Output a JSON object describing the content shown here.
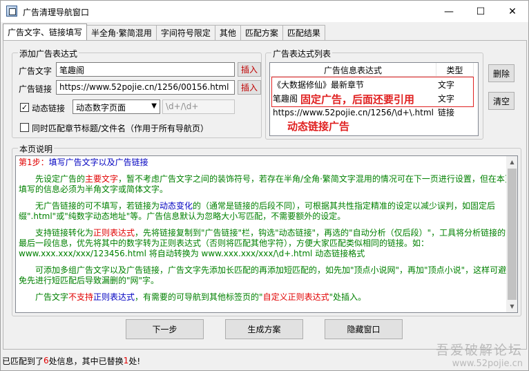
{
  "window": {
    "title": "广告清理导航窗口",
    "min_symbol": "—",
    "max_symbol": "☐",
    "close_symbol": "✕"
  },
  "tabs": [
    "广告文字、链接填写",
    "半全角·繁简混用",
    "字间符号限定",
    "其他",
    "匹配方案",
    "匹配结果"
  ],
  "add_group": {
    "title": "添加广告表达式",
    "ad_text_label": "广告文字",
    "ad_text_value": "笔趣阁",
    "ad_link_label": "广告链接",
    "ad_link_value": "https://www.52pojie.cn/1256/00156.html",
    "insert_label": "插入",
    "dynamic_label": "动态链接",
    "dynamic_checked": "✓",
    "dynamic_mode": "动态数字页面",
    "regex_value": "\\d+/\\d+",
    "match_title_label": "同时匹配章节标题/文件名（作用于所有导航页）"
  },
  "list_group": {
    "title": "广告表达式列表",
    "col_expr": "广告信息表达式",
    "col_type": "类型",
    "rows": [
      {
        "expr": "《大数据修仙》最新章节",
        "type": "文字"
      },
      {
        "expr": "笔趣阁",
        "type": "文字"
      },
      {
        "expr": "https://www.52pojie.cn/1256/\\d+\\.html",
        "type": "链接"
      }
    ],
    "annot_fixed": "固定广告，后面还要引用",
    "annot_dynamic": "动态链接广告",
    "delete_label": "删除",
    "clear_label": "清空"
  },
  "desc_group": {
    "title": "本页说明",
    "step": "第1步：",
    "step_text": "填写广告文字以及广告链接",
    "p1a": "　　先设定广告的",
    "p1b": "主要文字",
    "p1c": "，暂不考虑广告文字之间的装饰符号，若存在半角/全角·繁简文字混用的情况可在下一页进行设置，但在本页填写的信息必须为半角文字或简体文字。",
    "p2a": "　　无广告链接的可不填写，若链接为",
    "p2b": "动态变化",
    "p2c": "的（通常是链接的后段不同），可根据其共性指定精准的设定以减少误判，如固定后缀\".html\"或\"纯数字动态地址\"等。广告信息默认为忽略大小写匹配，不需要额外的设定。",
    "p3a": "　　支持链接转化为",
    "p3b": "正则表达式",
    "p3c": "，先将链接复制到\"广告链接\"栏，钩选\"动态链接\"，再选的\"自动分析（仅后段）\"，工具将分析链接的最后一段信息，优先将其中的数字转为正则表达式（否则将匹配其他字符），方便大家匹配类似相同的链接。如：www.xxx.xxx/xxx/123456.html 将自动转换为 www.xxx.xxx/xxx/\\d+.html 动态链接格式",
    "p4": "　　可添加多组广告文字以及广告链接，广告文字先添加长匹配的再添加短匹配的，如先加\"顶点小说网\"，再加\"顶点小说\"，这样可避免先进行短匹配后导致漏删的\"网\"字。",
    "p5a": "　　广告文字",
    "p5b": "不支持",
    "p5c": "正则表达式",
    "p5d": "，有需要的可导航到其他标签页的\"",
    "p5e": "自定义正则表达式",
    "p5f": "\"处插入。"
  },
  "buttons": {
    "next": "下一步",
    "generate": "生成方案",
    "hide": "隐藏窗口"
  },
  "status": {
    "prefix": "已匹配到了",
    "matched": "6",
    "middle": "处信息，其中已替换",
    "replaced": "1",
    "suffix": "处!"
  },
  "watermark": {
    "line1": "吾爱破解论坛",
    "line2": "www.52pojie.cn"
  }
}
